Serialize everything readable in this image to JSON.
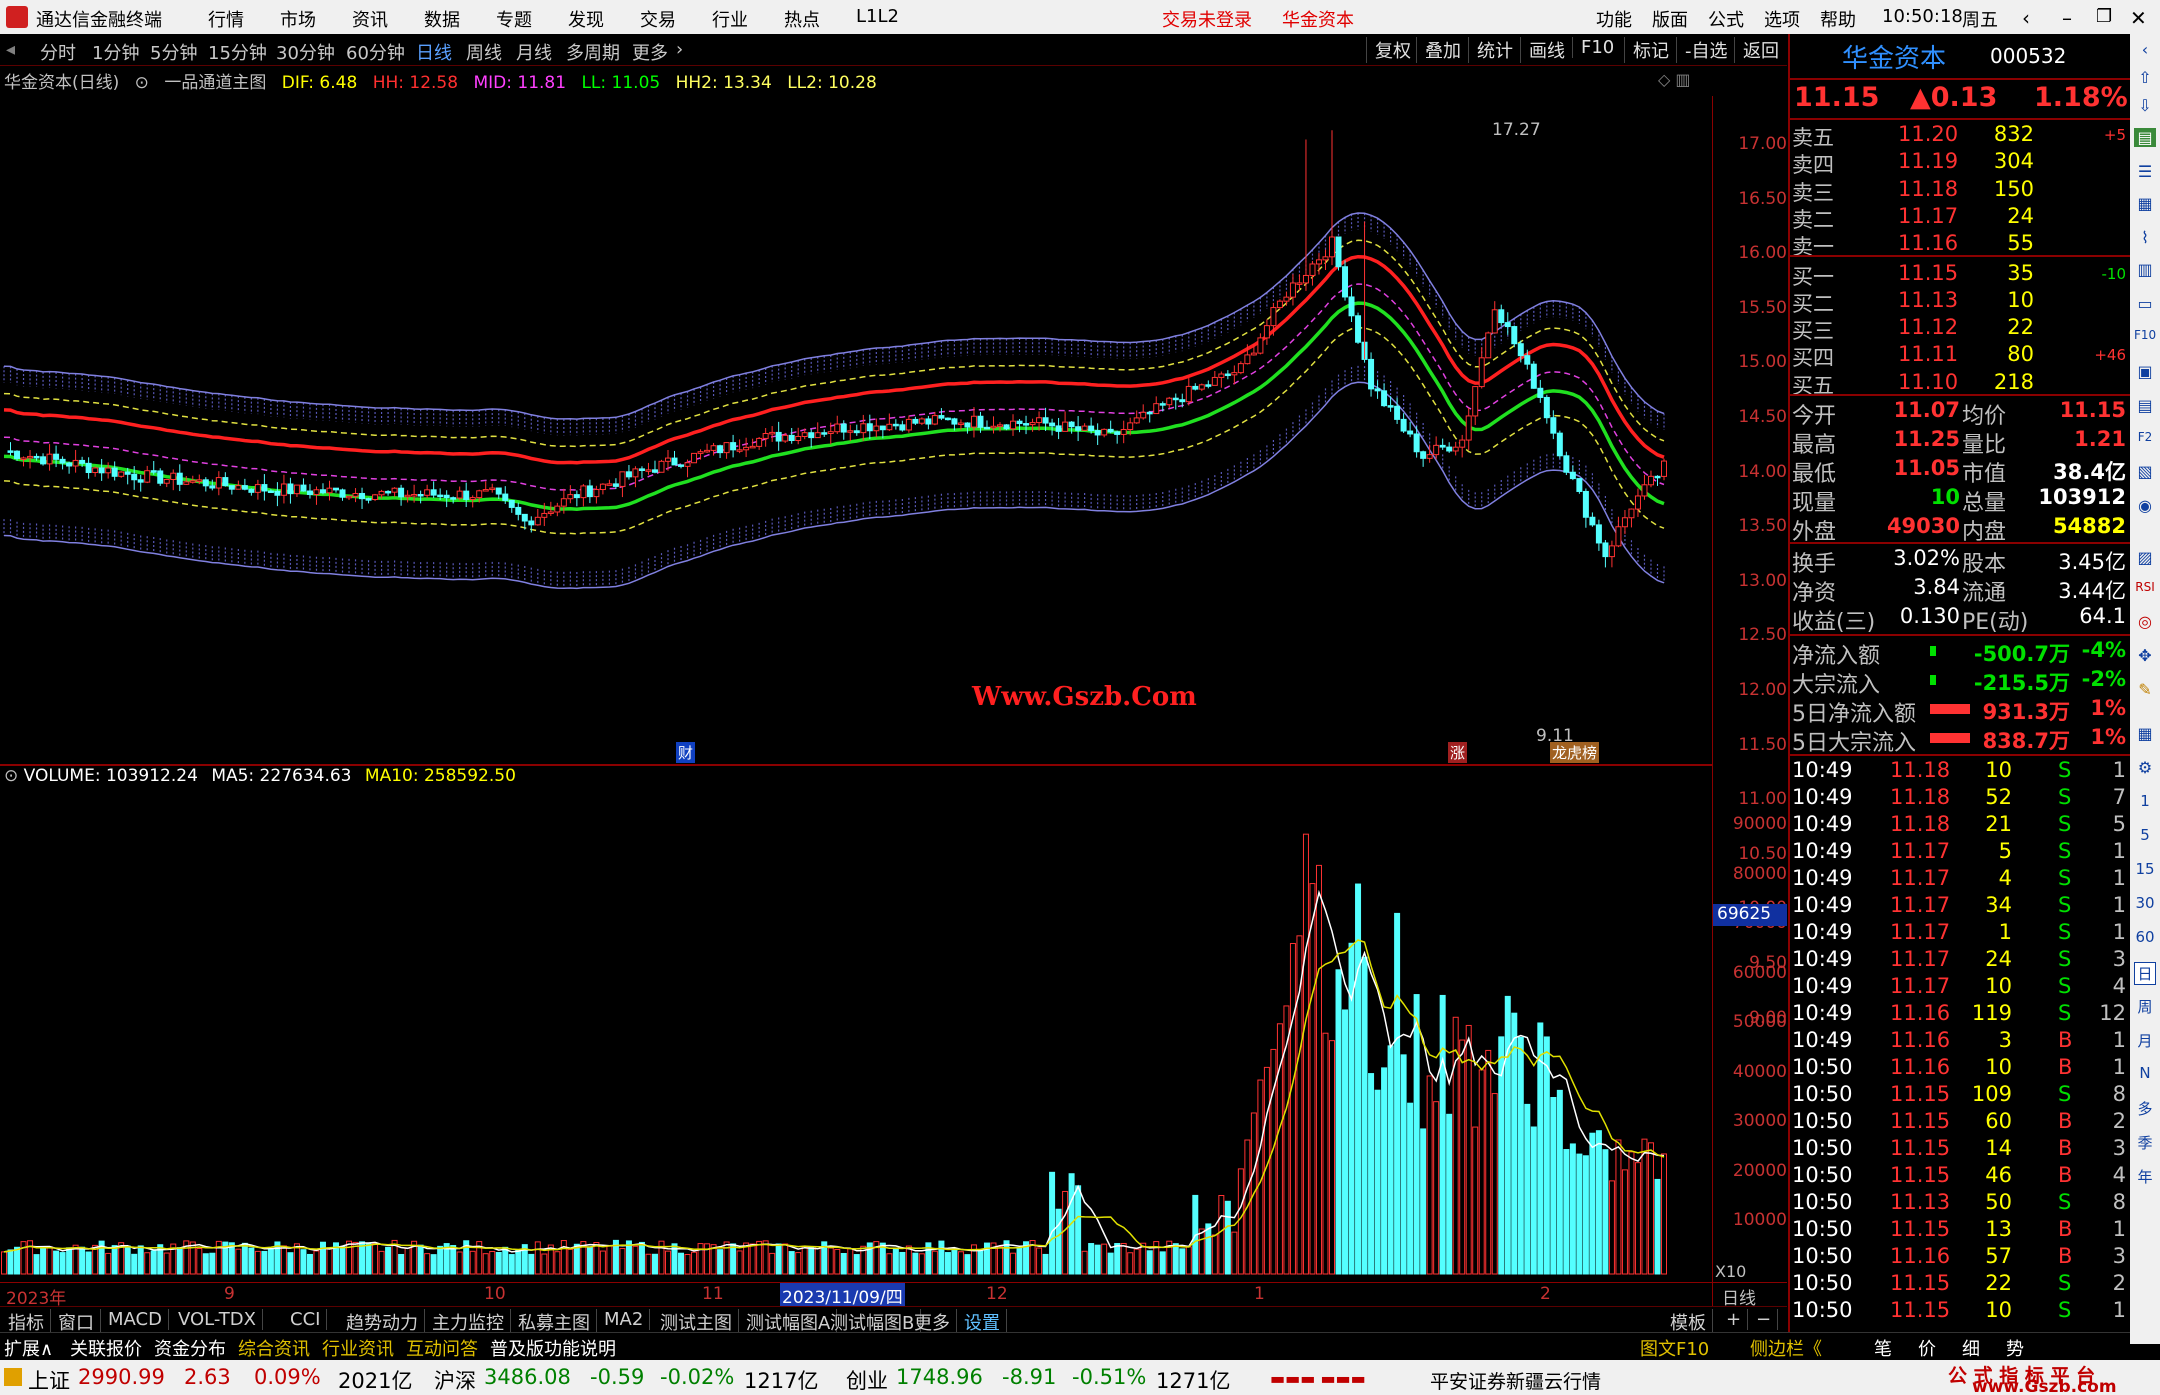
{
  "titlebar": {
    "app_name": "通达信金融终端",
    "menu": [
      "行情",
      "市场",
      "资讯",
      "数据",
      "专题",
      "发现",
      "交易",
      "行业",
      "热点",
      "L1L2"
    ],
    "login_status": "交易未登录",
    "broker": "华金资本",
    "right_menu": [
      "功能",
      "版面",
      "公式",
      "选项",
      "帮助"
    ],
    "time": "10:50:18",
    "weekday": "周五"
  },
  "periods": [
    "分时",
    "1分钟",
    "5分钟",
    "15分钟",
    "30分钟",
    "60分钟",
    "日线",
    "周线",
    "月线",
    "多周期",
    "更多"
  ],
  "active_period": "日线",
  "chart_tools": [
    "复权",
    "叠加",
    "统计",
    "画线",
    "F10",
    "标记",
    "-自选",
    "返回"
  ],
  "main_indicator": {
    "title": "华金资本(日线)",
    "formula": "一品通道主图",
    "dif": "DIF: 6.48",
    "hh": "HH: 12.58",
    "mid": "MID: 11.81",
    "ll": "LL: 11.05",
    "hh2": "HH2: 13.34",
    "ll2": "LL2: 10.28"
  },
  "volume_indicator": {
    "volume": "VOLUME: 103912.24",
    "ma5": "MA5: 227634.63",
    "ma10": "MA10: 258592.50"
  },
  "price_axis": [
    "17.00",
    "16.50",
    "16.00",
    "15.50",
    "15.00",
    "14.50",
    "14.00",
    "13.50",
    "13.00",
    "12.50",
    "12.00",
    "11.50",
    "11.00",
    "10.50",
    "10.00",
    "9.50",
    "9.00"
  ],
  "volume_axis": [
    "90000",
    "80000",
    "70000",
    "60000",
    "50000",
    "40000",
    "30000",
    "20000",
    "10000"
  ],
  "volume_marker": "69625",
  "volume_unit": "X10",
  "high_label": "17.27",
  "low_label": "9.11",
  "watermark": "Www.Gszb.Com",
  "event_markers": [
    "财",
    "涨",
    "龙虎榜"
  ],
  "date_axis": [
    "2023年",
    "9",
    "10",
    "11",
    "2023/11/09/四",
    "12",
    "1",
    "2"
  ],
  "date_axis_right": "日线",
  "stock": {
    "name": "华金资本",
    "code": "000532",
    "price": "11.15",
    "change": "▲0.13",
    "pct": "1.18%"
  },
  "order_book": {
    "asks": [
      {
        "label": "卖五",
        "price": "11.20",
        "vol": "832",
        "chg": "+5"
      },
      {
        "label": "卖四",
        "price": "11.19",
        "vol": "304",
        "chg": ""
      },
      {
        "label": "卖三",
        "price": "11.18",
        "vol": "150",
        "chg": ""
      },
      {
        "label": "卖二",
        "price": "11.17",
        "vol": "24",
        "chg": ""
      },
      {
        "label": "卖一",
        "price": "11.16",
        "vol": "55",
        "chg": ""
      }
    ],
    "bids": [
      {
        "label": "买一",
        "price": "11.15",
        "vol": "35",
        "chg": "-10"
      },
      {
        "label": "买二",
        "price": "11.13",
        "vol": "10",
        "chg": ""
      },
      {
        "label": "买三",
        "price": "11.12",
        "vol": "22",
        "chg": ""
      },
      {
        "label": "买四",
        "price": "11.11",
        "vol": "80",
        "chg": "+46"
      },
      {
        "label": "买五",
        "price": "11.10",
        "vol": "218",
        "chg": ""
      }
    ]
  },
  "quote_stats": [
    {
      "l1": "今开",
      "v1": "11.07",
      "c1": "red",
      "l2": "均价",
      "v2": "11.15",
      "c2": "red"
    },
    {
      "l1": "最高",
      "v1": "11.25",
      "c1": "red",
      "l2": "量比",
      "v2": "1.21",
      "c2": "red"
    },
    {
      "l1": "最低",
      "v1": "11.05",
      "c1": "red",
      "l2": "市值",
      "v2": "38.4亿",
      "c2": "white"
    },
    {
      "l1": "现量",
      "v1": "10",
      "c1": "green",
      "l2": "总量",
      "v2": "103912",
      "c2": "white"
    },
    {
      "l1": "外盘",
      "v1": "49030",
      "c1": "red",
      "l2": "内盘",
      "v2": "54882",
      "c2": "yellow"
    }
  ],
  "fund_stats": [
    {
      "l1": "换手",
      "v1": "3.02%",
      "l2": "股本",
      "v2": "3.45亿"
    },
    {
      "l1": "净资",
      "v1": "3.84",
      "l2": "流通",
      "v2": "3.44亿"
    },
    {
      "l1": "收益(三)",
      "v1": "0.130",
      "l2": "PE(动)",
      "v2": "64.1"
    }
  ],
  "flows": [
    {
      "label": "净流入额",
      "value": "-500.7万",
      "pct": "-4%",
      "color": "green",
      "bar": 0.04
    },
    {
      "label": "大宗流入",
      "value": "-215.5万",
      "pct": "-2%",
      "color": "green",
      "bar": 0.02
    },
    {
      "label": "5日净流入额",
      "value": "931.3万",
      "pct": "1%",
      "color": "red",
      "bar": 0.5
    },
    {
      "label": "5日大宗流入",
      "value": "838.7万",
      "pct": "1%",
      "color": "red",
      "bar": 0.5
    }
  ],
  "ticks": [
    {
      "t": "10:49",
      "p": "11.18",
      "v": "10",
      "d": "S",
      "n": "1"
    },
    {
      "t": "10:49",
      "p": "11.18",
      "v": "52",
      "d": "S",
      "n": "7"
    },
    {
      "t": "10:49",
      "p": "11.18",
      "v": "21",
      "d": "S",
      "n": "5"
    },
    {
      "t": "10:49",
      "p": "11.17",
      "v": "5",
      "d": "S",
      "n": "1"
    },
    {
      "t": "10:49",
      "p": "11.17",
      "v": "4",
      "d": "S",
      "n": "1"
    },
    {
      "t": "10:49",
      "p": "11.17",
      "v": "34",
      "d": "S",
      "n": "1"
    },
    {
      "t": "10:49",
      "p": "11.17",
      "v": "1",
      "d": "S",
      "n": "1"
    },
    {
      "t": "10:49",
      "p": "11.17",
      "v": "24",
      "d": "S",
      "n": "3"
    },
    {
      "t": "10:49",
      "p": "11.17",
      "v": "10",
      "d": "S",
      "n": "4"
    },
    {
      "t": "10:49",
      "p": "11.16",
      "v": "119",
      "d": "S",
      "n": "12"
    },
    {
      "t": "10:49",
      "p": "11.16",
      "v": "3",
      "d": "B",
      "n": "1"
    },
    {
      "t": "10:50",
      "p": "11.16",
      "v": "10",
      "d": "B",
      "n": "1"
    },
    {
      "t": "10:50",
      "p": "11.15",
      "v": "109",
      "d": "S",
      "n": "8"
    },
    {
      "t": "10:50",
      "p": "11.15",
      "v": "60",
      "d": "B",
      "n": "2"
    },
    {
      "t": "10:50",
      "p": "11.15",
      "v": "14",
      "d": "B",
      "n": "3"
    },
    {
      "t": "10:50",
      "p": "11.15",
      "v": "46",
      "d": "B",
      "n": "4"
    },
    {
      "t": "10:50",
      "p": "11.13",
      "v": "50",
      "d": "S",
      "n": "8"
    },
    {
      "t": "10:50",
      "p": "11.15",
      "v": "13",
      "d": "B",
      "n": "1"
    },
    {
      "t": "10:50",
      "p": "11.16",
      "v": "57",
      "d": "B",
      "n": "3"
    },
    {
      "t": "10:50",
      "p": "11.15",
      "v": "22",
      "d": "S",
      "n": "2"
    },
    {
      "t": "10:50",
      "p": "11.15",
      "v": "10",
      "d": "S",
      "n": "1"
    }
  ],
  "bottom_tabs": [
    "指标",
    "窗口",
    "MACD",
    "VOL-TDX",
    "CCI",
    "趋势动力",
    "主力监控",
    "私募主图",
    "MA2",
    "测试主图",
    "测试幅图A",
    "测试幅图B",
    "更多",
    "设置"
  ],
  "bottom_right": [
    "模板",
    "+",
    "−"
  ],
  "ext_tabs": [
    "扩展∧",
    "关联报价",
    "资金分布",
    "综合资讯",
    "行业资讯",
    "互动问答",
    "普及版功能说明"
  ],
  "ext_right": [
    "图文F10",
    "侧边栏《",
    "笔",
    "价",
    "细",
    "势"
  ],
  "vstrip": [
    "1",
    "5",
    "15",
    "30",
    "60",
    "日",
    "周",
    "月",
    "N",
    "多",
    "季",
    "年"
  ],
  "indices": [
    {
      "name": "上证",
      "value": "2990.99",
      "chg": "2.63",
      "pct": "0.09%",
      "amt": "2021亿"
    },
    {
      "name": "沪深",
      "value": "3486.08",
      "chg": "-0.59",
      "pct": "-0.02%",
      "amt": "1217亿"
    },
    {
      "name": "创业",
      "value": "1748.96",
      "chg": "-8.91",
      "pct": "-0.51%",
      "amt": "1271亿"
    }
  ],
  "status_right": "平安证券新疆云行情",
  "brand_footer": {
    "line1": "公 式 指 标 平 台",
    "line2": "www.Gszb.com"
  },
  "colors": {
    "up": "#ff3232",
    "down": "#00e0e0",
    "ma_red": "#ff2020",
    "ma_green": "#20e020",
    "band": "#6060c0"
  }
}
